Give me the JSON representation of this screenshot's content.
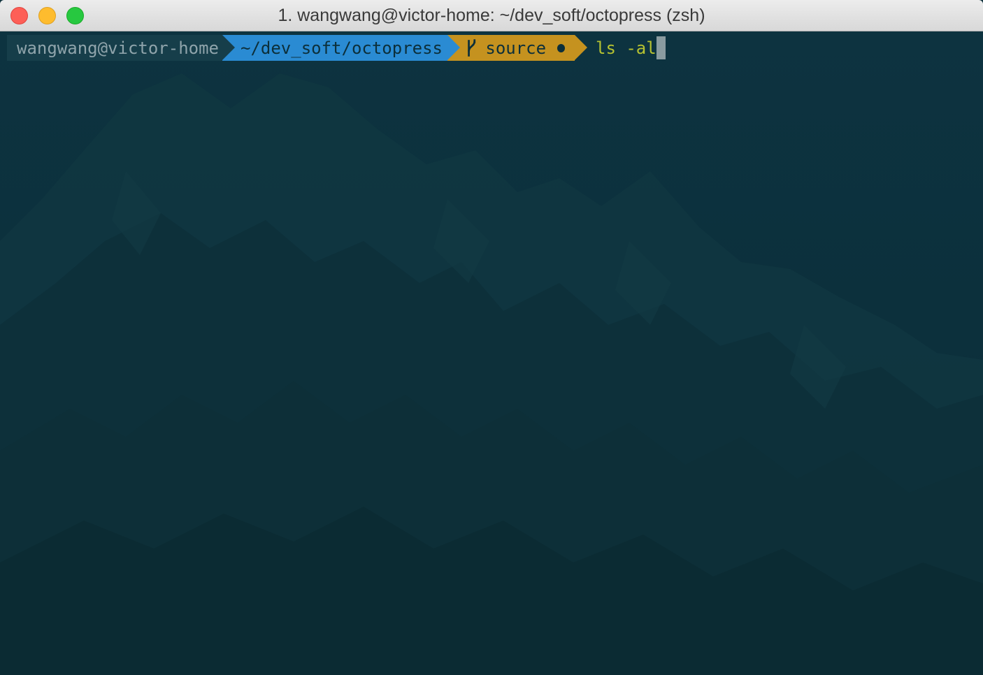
{
  "window": {
    "title": "1. wangwang@victor-home: ~/dev_soft/octopress (zsh)"
  },
  "prompt": {
    "user_host": "wangwang@victor-home",
    "path": "~/dev_soft/octopress",
    "branch": "source",
    "branch_icon": "git-branch-icon",
    "dirty_indicator": "dirty-dot",
    "command": "ls -al"
  },
  "colors": {
    "terminal_bg": "#0c2f3a",
    "user_segment_bg": "#163e4a",
    "path_segment_bg": "#2a8bd3",
    "git_segment_bg": "#c5921f",
    "command_fg": "#b6c231"
  }
}
